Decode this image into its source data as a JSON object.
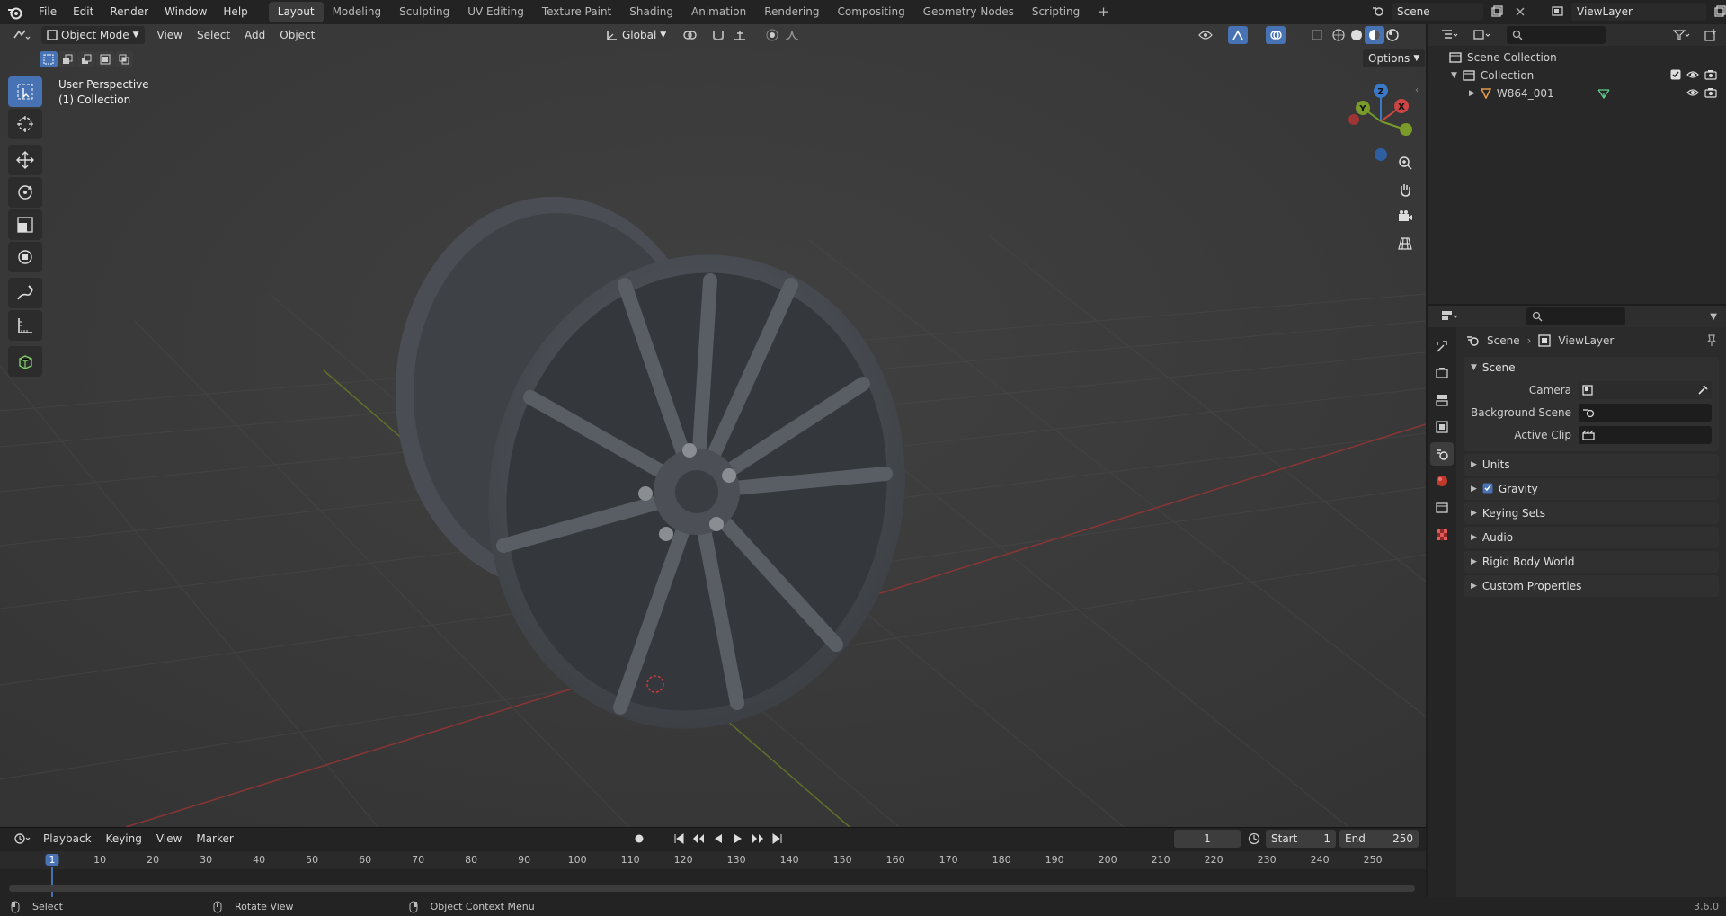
{
  "topbar": {
    "menus": [
      "File",
      "Edit",
      "Render",
      "Window",
      "Help"
    ],
    "workspaces": [
      {
        "label": "Layout",
        "active": true
      },
      {
        "label": "Modeling",
        "active": false
      },
      {
        "label": "Sculpting",
        "active": false
      },
      {
        "label": "UV Editing",
        "active": false
      },
      {
        "label": "Texture Paint",
        "active": false
      },
      {
        "label": "Shading",
        "active": false
      },
      {
        "label": "Animation",
        "active": false
      },
      {
        "label": "Rendering",
        "active": false
      },
      {
        "label": "Compositing",
        "active": false
      },
      {
        "label": "Geometry Nodes",
        "active": false
      },
      {
        "label": "Scripting",
        "active": false
      }
    ],
    "add_workspace": "+",
    "scene": "Scene",
    "view_layer": "ViewLayer"
  },
  "viewport": {
    "mode": "Object Mode",
    "menus": [
      "View",
      "Select",
      "Add",
      "Object"
    ],
    "orientation": "Global",
    "options": "Options",
    "overlay_line1": "User Perspective",
    "overlay_line2": "(1) Collection",
    "gizmo": {
      "x": "X",
      "y": "Y",
      "z": "Z"
    },
    "tools": [
      "select-box-icon",
      "cursor-icon",
      "move-icon",
      "rotate-icon",
      "scale-icon",
      "transform-icon",
      "annotate-icon",
      "measure-icon",
      "add-cube-icon"
    ]
  },
  "timeline": {
    "menus": [
      "Playback",
      "Keying",
      "View",
      "Marker"
    ],
    "current_frame": "1",
    "start_label": "Start",
    "start": "1",
    "end_label": "End",
    "end": "250",
    "ticks": [
      "1",
      "10",
      "20",
      "30",
      "40",
      "50",
      "60",
      "70",
      "80",
      "90",
      "100",
      "110",
      "120",
      "130",
      "140",
      "150",
      "160",
      "170",
      "180",
      "190",
      "200",
      "210",
      "220",
      "230",
      "240",
      "250"
    ]
  },
  "statusbar": {
    "select": "Select",
    "rotate": "Rotate View",
    "context": "Object Context Menu",
    "version": "3.6.0"
  },
  "outliner": {
    "scene_collection": "Scene Collection",
    "collection": "Collection",
    "object": "W864_001"
  },
  "properties": {
    "breadcrumb_scene": "Scene",
    "breadcrumb_layer": "ViewLayer",
    "panel_scene": "Scene",
    "camera_label": "Camera",
    "bg_scene_label": "Background Scene",
    "active_clip_label": "Active Clip",
    "panels": [
      "Units",
      "Gravity",
      "Keying Sets",
      "Audio",
      "Rigid Body World",
      "Custom Properties"
    ]
  },
  "colors": {
    "accent": "#4772b3",
    "x_axis": "#cc4444",
    "y_axis": "#7a9a2a",
    "z_axis": "#3a78c8"
  }
}
